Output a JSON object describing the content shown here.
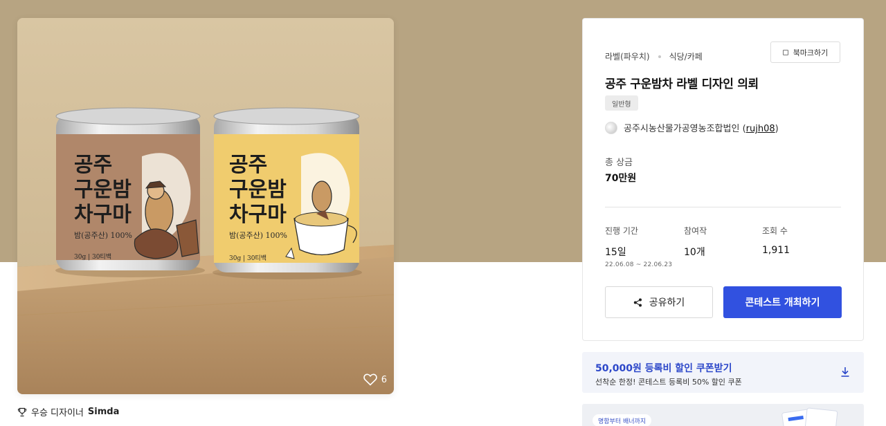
{
  "product": {
    "image_alt": "공주 구운밤 차구마 캔 패키지 디자인",
    "can_left_text": [
      "공주",
      "구운밤",
      "차구마"
    ],
    "can_left_sub": "밤(공주산) 100%",
    "can_left_foot": "30g | 30티백",
    "can_right_text": [
      "공주",
      "구운밤",
      "차구마"
    ],
    "can_right_sub": "밤(공주산) 100%",
    "can_right_foot": "30g | 30티백",
    "likes_count": "6",
    "winner_prefix": "우승 디자이너",
    "winner_name": "Simda"
  },
  "panel": {
    "category_primary": "라벨(파우치)",
    "category_secondary": "식당/카페",
    "bookmark_label": "북마크하기",
    "title": "공주 구운밤차 라벨 디자인 의뢰",
    "badge": "일반형",
    "host_name": "공주시농산물가공영농조합법인 (",
    "host_id": "rujh08",
    "host_close": ")",
    "prize_label": "총 상금",
    "prize_value": "70만원",
    "stats": [
      {
        "label": "진행 기간",
        "value": "15일",
        "sub": "22.06.08 ~ 22.06.23"
      },
      {
        "label": "참여작",
        "value": "10개",
        "sub": ""
      },
      {
        "label": "조회 수",
        "value": "1,911",
        "sub": ""
      }
    ],
    "share_label": "공유하기",
    "host_contest_label": "콘테스트 개최하기"
  },
  "coupon": {
    "title": "50,000원 등록비 할인 쿠폰받기",
    "subtitle": "선착순 한정! 콘테스트 등록비 50% 할인 쿠폰"
  },
  "promo": {
    "tag": "명함부터 배너까지"
  },
  "colors": {
    "hero_bg": "#b7a482",
    "primary_button": "#3151e0",
    "coupon_text": "#2c47c9",
    "can_left": "#b0876a",
    "can_right": "#f0cc6e"
  },
  "icons": [
    "heart-icon",
    "trophy-icon",
    "bookmark-icon",
    "share-icon",
    "download-icon"
  ]
}
